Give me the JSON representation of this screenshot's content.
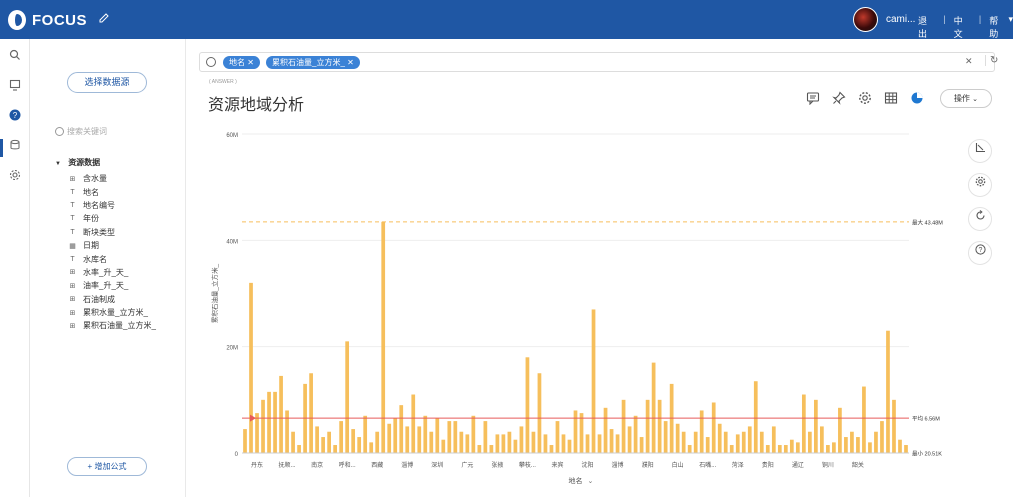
{
  "topbar": {
    "brand": "FOCUS",
    "user_name": "cami...",
    "links": [
      "退出",
      "中文",
      "帮助"
    ],
    "help_arrow": "▾"
  },
  "icons": {
    "nav": [
      "search-icon",
      "dashboard-icon",
      "question-icon",
      "database-icon",
      "settings-icon"
    ],
    "edit": "edit-icon"
  },
  "sidebar": {
    "select_datasource": "选择数据源",
    "search_placeholder": "搜索关键词",
    "tree_root": "资源数据",
    "fields": [
      {
        "type": "measure",
        "label": "含水量"
      },
      {
        "type": "text",
        "label": "地名"
      },
      {
        "type": "text",
        "label": "地名编号"
      },
      {
        "type": "text",
        "label": "年份"
      },
      {
        "type": "text",
        "label": "断块类型"
      },
      {
        "type": "date",
        "label": "日期"
      },
      {
        "type": "text",
        "label": "水库名"
      },
      {
        "type": "measure",
        "label": "水率_升_天_"
      },
      {
        "type": "measure",
        "label": "油率_升_天_"
      },
      {
        "type": "measure",
        "label": "石油制成"
      },
      {
        "type": "measure",
        "label": "累积水量_立方米_"
      },
      {
        "type": "measure",
        "label": "累积石油量_立方米_"
      }
    ],
    "add_formula": "增加公式"
  },
  "query": {
    "tokens": [
      "地名",
      "累积石油量_立方米_"
    ],
    "answer_tag": "( ANSWER )"
  },
  "main": {
    "title": "资源地域分析",
    "ops_button": "操作"
  },
  "colors": {
    "topbar": "#1f57a4",
    "bar": "#f6bf5c",
    "max_line": "#f6bf5c",
    "avg_line": "#e85a5a",
    "token": "#3b82d6"
  },
  "chart_data": {
    "type": "bar",
    "ylabel": "累积石油量_立方米_",
    "xlabel": "地名",
    "y_ticks": [
      "0",
      "20M",
      "40M",
      "60M"
    ],
    "ylim": [
      0,
      60000000
    ],
    "reference_lines": [
      {
        "label": "最大 43.48M",
        "value": 43480000,
        "style": "dashed"
      },
      {
        "label": "平均 6.56M",
        "value": 6560000,
        "style": "solid"
      },
      {
        "label": "最小 20.51K",
        "value": 20510,
        "style": "none"
      }
    ],
    "category_labels": [
      {
        "index": 2,
        "label": "丹东"
      },
      {
        "index": 7,
        "label": "抚顺..."
      },
      {
        "index": 12,
        "label": "南京"
      },
      {
        "index": 17,
        "label": "呼和..."
      },
      {
        "index": 22,
        "label": "西藏"
      },
      {
        "index": 27,
        "label": "淄博"
      },
      {
        "index": 32,
        "label": "深圳"
      },
      {
        "index": 37,
        "label": "广元"
      },
      {
        "index": 42,
        "label": "张掖"
      },
      {
        "index": 47,
        "label": "攀枝..."
      },
      {
        "index": 52,
        "label": "来宾"
      },
      {
        "index": 57,
        "label": "沈阳"
      },
      {
        "index": 62,
        "label": "淄博"
      },
      {
        "index": 67,
        "label": "濮阳"
      },
      {
        "index": 72,
        "label": "白山"
      },
      {
        "index": 77,
        "label": "石嘴..."
      },
      {
        "index": 82,
        "label": "菏泽"
      },
      {
        "index": 87,
        "label": "贵阳"
      },
      {
        "index": 92,
        "label": "通辽"
      },
      {
        "index": 97,
        "label": "铜川"
      },
      {
        "index": 102,
        "label": "韶关"
      }
    ],
    "values": [
      4.5,
      32,
      7.5,
      10,
      11.5,
      11.5,
      14.5,
      8,
      4,
      1.5,
      13,
      15,
      5,
      3,
      4,
      1.5,
      6,
      21,
      4.5,
      3,
      7,
      2,
      4,
      43.48,
      5.5,
      6.5,
      9,
      5,
      11,
      5,
      7,
      4,
      6.5,
      2.5,
      6,
      6,
      4,
      3.5,
      7,
      1.5,
      6,
      1.5,
      3.5,
      3.5,
      4,
      2.5,
      5,
      18,
      4,
      15,
      3.5,
      1.5,
      6,
      3.5,
      2.5,
      8,
      7.5,
      3.5,
      27,
      3.5,
      8.5,
      4.5,
      3.5,
      10,
      5,
      7,
      3,
      10,
      17,
      10,
      6,
      13,
      5.5,
      4,
      1.5,
      4,
      8,
      3,
      9.5,
      5.5,
      4,
      1.5,
      3.5,
      4,
      5,
      13.5,
      4,
      1.5,
      5,
      1.5,
      1.5,
      2.5,
      2,
      11,
      4,
      10,
      5,
      1.5,
      2,
      8.5,
      3,
      4,
      3,
      12.5,
      2,
      4,
      6,
      23,
      10,
      2.5,
      1.5
    ]
  }
}
